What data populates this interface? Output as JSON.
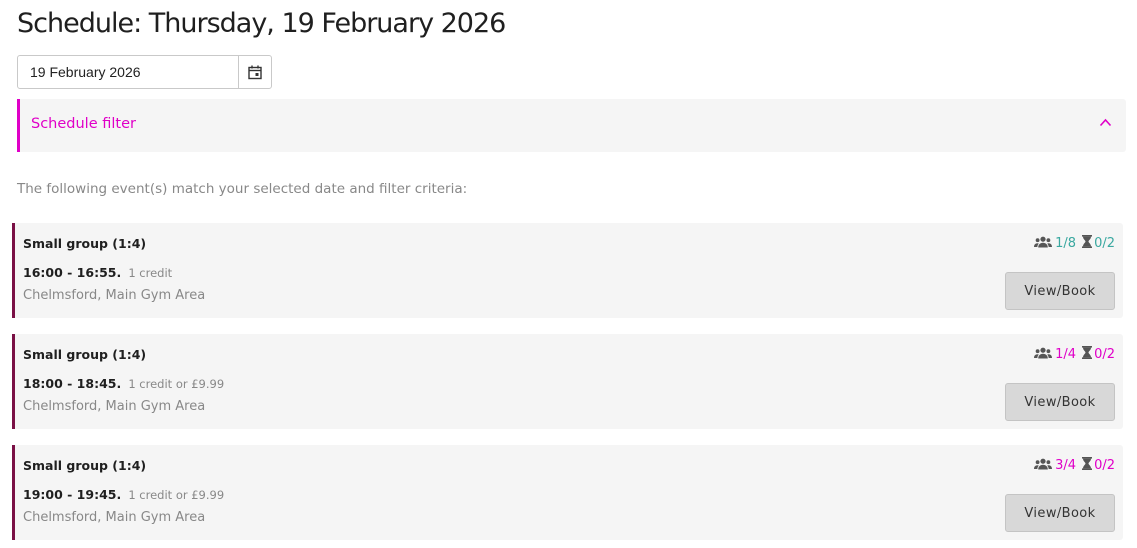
{
  "page": {
    "title": "Schedule: Thursday, 19 February 2026"
  },
  "date_picker": {
    "value": "19 February 2026",
    "icon": "calendar-icon"
  },
  "filter": {
    "label": "Schedule filter",
    "icon": "chevron-up-icon"
  },
  "intro_text": "The following event(s) match your selected date and filter criteria:",
  "colors": {
    "accent": "#e000c8",
    "event_border": "#7a1045",
    "available_teal": "#3aa8a0",
    "full_magenta": "#e000c8"
  },
  "events": [
    {
      "title": "Small group (1:4)",
      "time": "16:00 - 16:55.",
      "price": "1 credit",
      "location": "Chelmsford, Main Gym Area",
      "attendees": "1/8",
      "waitlist": "0/2",
      "status_color": "#3aa8a0",
      "button_label": "View/Book"
    },
    {
      "title": "Small group (1:4)",
      "time": "18:00 - 18:45.",
      "price": "1 credit or £9.99",
      "location": "Chelmsford, Main Gym Area",
      "attendees": "1/4",
      "waitlist": "0/2",
      "status_color": "#e000c8",
      "button_label": "View/Book"
    },
    {
      "title": "Small group (1:4)",
      "time": "19:00 - 19:45.",
      "price": "1 credit or £9.99",
      "location": "Chelmsford, Main Gym Area",
      "attendees": "3/4",
      "waitlist": "0/2",
      "status_color": "#e000c8",
      "button_label": "View/Book"
    }
  ]
}
